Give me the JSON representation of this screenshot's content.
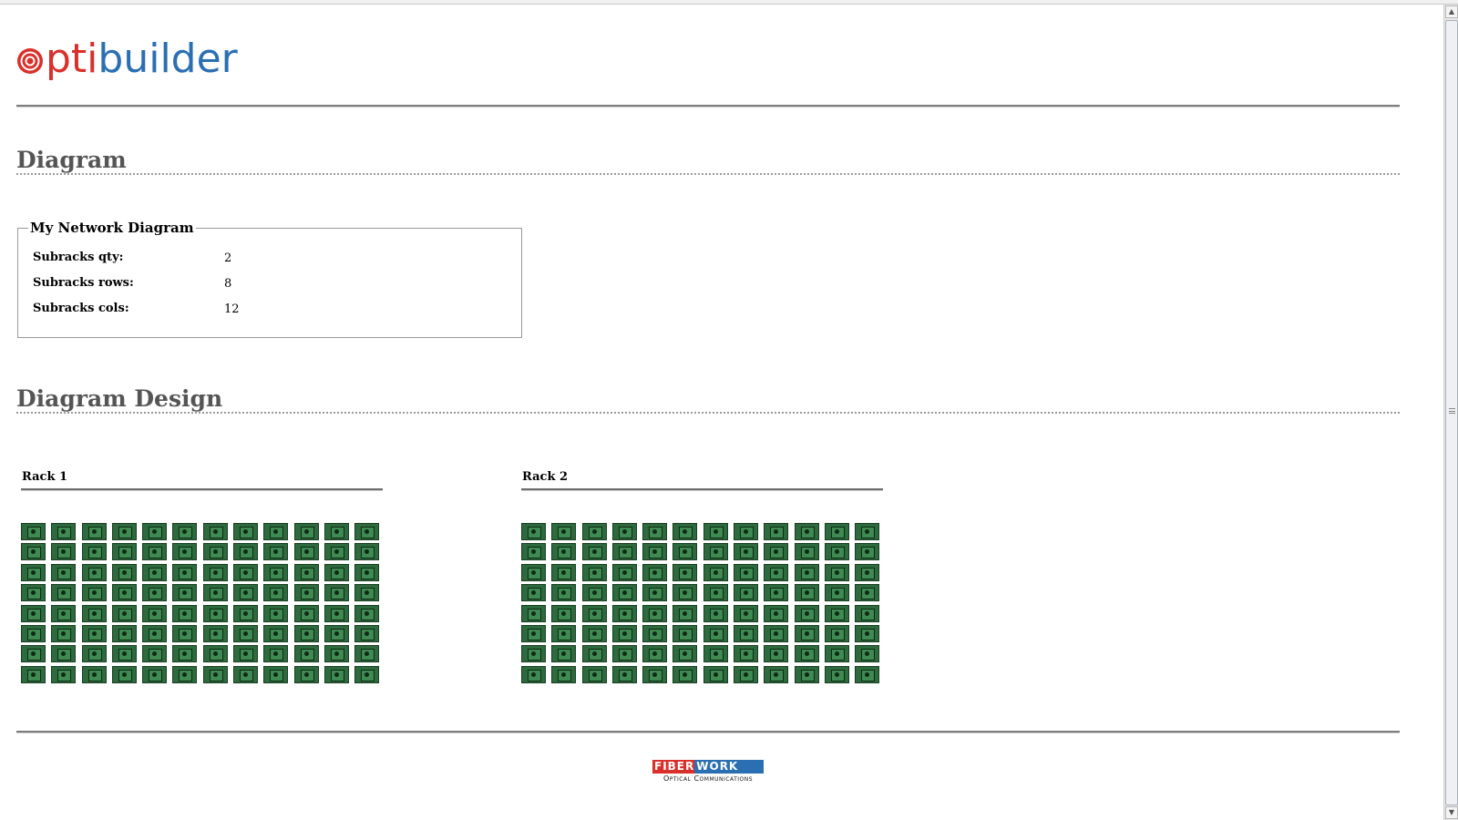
{
  "header": {
    "logo": {
      "red_text": "pti",
      "blue_text": "builder",
      "colors": {
        "red": "#d9302b",
        "blue": "#2b6fb3"
      }
    }
  },
  "sections": {
    "diagram_title": "Diagram",
    "design_title": "Diagram Design"
  },
  "diagram_info": {
    "legend": "My Network Diagram",
    "fields": [
      {
        "label": "Subracks qty:",
        "value": "2"
      },
      {
        "label": "Subracks rows:",
        "value": "8"
      },
      {
        "label": "Subracks cols:",
        "value": "12"
      }
    ]
  },
  "racks": [
    {
      "title": "Rack 1",
      "rows": 8,
      "cols": 12
    },
    {
      "title": "Rack 2",
      "rows": 8,
      "cols": 12
    }
  ],
  "slot_icon": "subrack-slot-icon",
  "slot_color": "#2d6a3d",
  "footer": {
    "brand_part1": "FIBER",
    "brand_part2": "WORK",
    "brand_tagline": "Optical Communications"
  }
}
